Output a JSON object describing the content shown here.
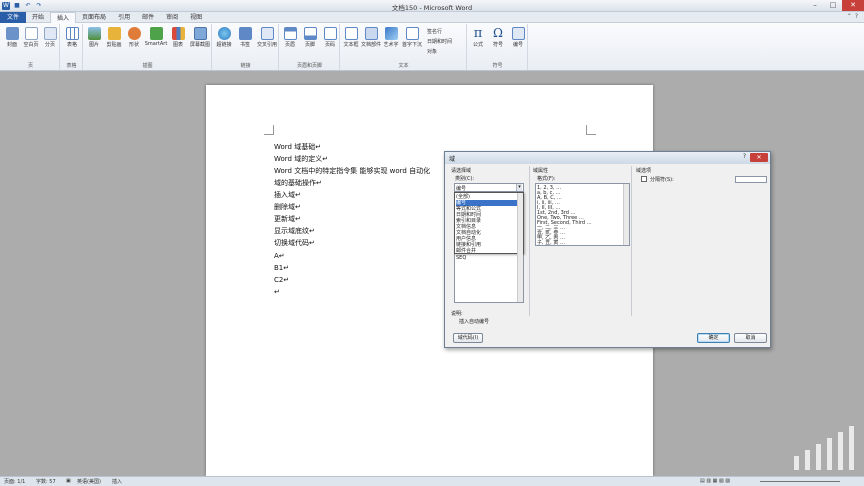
{
  "window": {
    "title": "文档150 - Microsoft Word"
  },
  "qat": {
    "icons": [
      "word-icon",
      "save-icon",
      "undo-icon",
      "redo-icon"
    ]
  },
  "tabs": [
    {
      "label": "文件",
      "kind": "file"
    },
    {
      "label": "开始",
      "kind": "normal"
    },
    {
      "label": "插入",
      "kind": "active"
    },
    {
      "label": "页面布局",
      "kind": "normal"
    },
    {
      "label": "引用",
      "kind": "normal"
    },
    {
      "label": "邮件",
      "kind": "normal"
    },
    {
      "label": "审阅",
      "kind": "normal"
    },
    {
      "label": "视图",
      "kind": "normal"
    }
  ],
  "ribbon": {
    "groups": {
      "pages": "页",
      "tables": "表格",
      "illustrations": "插图",
      "links": "链接",
      "header_footer": "页眉和页脚",
      "text": "文本",
      "symbols": "符号"
    },
    "buttons": {
      "cover": "封面",
      "blank_page": "空白页",
      "page_break": "分页",
      "table": "表格",
      "picture": "图片",
      "clipart": "剪贴画",
      "shapes": "形状",
      "smartart": "SmartArt",
      "chart": "图表",
      "screenshot": "屏幕截图",
      "hyperlink": "超链接",
      "bookmark": "书签",
      "crossref": "交叉引用",
      "header": "页眉",
      "footer": "页脚",
      "page_number": "页码",
      "textbox": "文本框",
      "quickparts": "文档部件",
      "wordart": "艺术字",
      "dropcap": "首字下沉",
      "signature": "签名行",
      "datetime": "日期和时间",
      "object": "对象",
      "equation": "公式",
      "symbol": "符号",
      "numbering": "编号"
    },
    "glyphs": {
      "pi": "π",
      "omega": "Ω"
    }
  },
  "document": {
    "lines": [
      "Word 域基础↵",
      "Word 域的定义↵",
      "Word 文档中的特定指令集 能够实现 word 自动化",
      "域的基础操作↵",
      "插入域↵",
      "删除域↵",
      "更新域↵",
      "显示域底纹↵",
      "切换域代码↵",
      "A↵",
      "B1↵",
      "C2↵",
      "↵"
    ]
  },
  "dialog": {
    "title": "域",
    "help": "?",
    "close": "✕",
    "choose_field": "请选择域",
    "category_label": "类别(C):",
    "category_value": "编号",
    "category_options": [
      "(全部)",
      "编号",
      "等式和公式",
      "日期和时间",
      "索引和目录",
      "文档信息",
      "文档自动化",
      "用户信息",
      "链接和引用",
      "邮件合并"
    ],
    "category_selected_index": 1,
    "field_names_extra": [
      "SEQ"
    ],
    "field_props": "域属性",
    "format_label": "格式(F):",
    "formats": [
      "1, 2, 3, …",
      "a, b, c, …",
      "A, B, C, …",
      "i, ii, iii, …",
      "I, II, III, …",
      "1st, 2nd, 3rd …",
      "One, Two, Three …",
      "First, Second, Third …",
      "一, 二, 三 …",
      "壹, 贰, 叁 …",
      "甲, 乙, 丙 …",
      "子, 丑, 寅 …"
    ],
    "field_options": "域选项",
    "separator_label": "分隔符(S):",
    "description_label": "说明:",
    "description": "插入自动编号",
    "field_codes_button": "域代码(I)",
    "ok": "确定",
    "cancel": "取消"
  },
  "status": {
    "page": "页面: 1/1",
    "words": "字数: 57",
    "language": "英语(美国)",
    "mode": "插入"
  }
}
